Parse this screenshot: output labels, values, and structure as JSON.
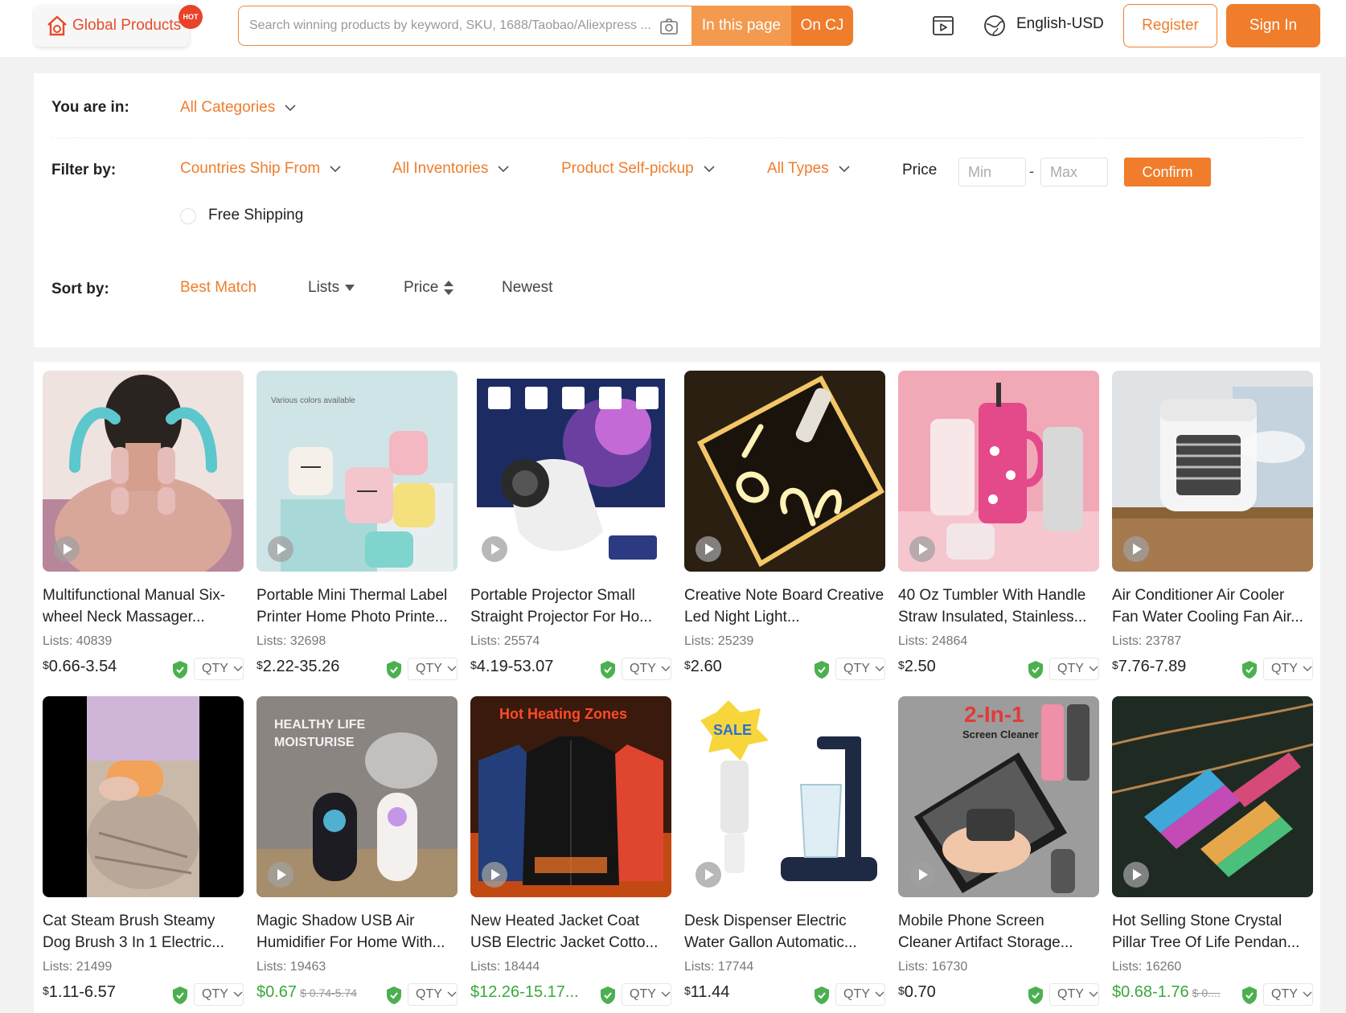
{
  "header": {
    "logo_label": "Global Products",
    "hot_badge": "HOT",
    "search_placeholder": "Search winning products by keyword, SKU, 1688/Taobao/Aliexpress ...",
    "in_page_button": "In this page",
    "on_cj_button": "On CJ",
    "language": "English-USD",
    "register": "Register",
    "sign_in": "Sign In"
  },
  "filters": {
    "location_label": "You are in:",
    "category": "All Categories",
    "filter_label": "Filter by:",
    "ship_from": "Countries Ship From",
    "inventories": "All Inventories",
    "self_pickup": "Product Self-pickup",
    "types": "All Types",
    "price_label": "Price",
    "min_placeholder": "Min",
    "max_placeholder": "Max",
    "dash": "-",
    "confirm": "Confirm",
    "free_shipping": "Free Shipping",
    "sort_label": "Sort by:",
    "sort_options": [
      "Best Match",
      "Lists",
      "Price",
      "Newest"
    ],
    "sort_active": "Best Match"
  },
  "products": [
    {
      "title": "Multifunctional Manual Six-wheel Neck Massager...",
      "lists": "Lists: 40839",
      "price": "0.66-3.54",
      "currency": "$",
      "qty": "QTY"
    },
    {
      "title": "Portable Mini Thermal Label Printer Home Photo Printe...",
      "lists": "Lists: 32698",
      "price": "2.22-35.26",
      "currency": "$",
      "qty": "QTY"
    },
    {
      "title": "Portable Projector Small Straight Projector For Ho...",
      "lists": "Lists: 25574",
      "price": "4.19-53.07",
      "currency": "$",
      "qty": "QTY"
    },
    {
      "title": "Creative Note Board Creative Led Night Light...",
      "lists": "Lists: 25239",
      "price": "2.60",
      "currency": "$",
      "qty": "QTY"
    },
    {
      "title": "40 Oz Tumbler With Handle Straw Insulated, Stainless...",
      "lists": "Lists: 24864",
      "price": "2.50",
      "currency": "$",
      "qty": "QTY"
    },
    {
      "title": "Air Conditioner Air Cooler Fan Water Cooling Fan Air...",
      "lists": "Lists: 23787",
      "price": "7.76-7.89",
      "currency": "$",
      "qty": "QTY"
    },
    {
      "title": "Cat Steam Brush Steamy Dog Brush 3 In 1 Electric...",
      "lists": "Lists: 21499",
      "price": "1.11-6.57",
      "currency": "$",
      "qty": "QTY"
    },
    {
      "title": "Magic Shadow USB Air Humidifier For Home With...",
      "lists": "Lists: 19463",
      "price": "$0.67",
      "original": "$ 0.74-5.74",
      "qty": "QTY"
    },
    {
      "title": "New Heated Jacket Coat USB Electric Jacket Cotto...",
      "lists": "Lists: 18444",
      "price": "$12.26-15.17...",
      "qty": "QTY"
    },
    {
      "title": "Desk Dispenser Electric Water Gallon Automatic...",
      "lists": "Lists: 17744",
      "price": "11.44",
      "currency": "$",
      "qty": "QTY"
    },
    {
      "title": "Mobile Phone Screen Cleaner Artifact Storage...",
      "lists": "Lists: 16730",
      "price": "0.70",
      "currency": "$",
      "qty": "QTY"
    },
    {
      "title": "Hot Selling Stone Crystal Pillar Tree Of Life Pendan...",
      "lists": "Lists: 16260",
      "price": "$0.68-1.76",
      "original": "$ 0....",
      "qty": "QTY"
    }
  ],
  "image_text": {
    "printer_caption": "Various colors available",
    "humidifier_line1": "HEALTHY LIFE",
    "humidifier_line2": "MOISTURISE",
    "jacket_banner": "Hot Heating Zones",
    "dispenser_badge": "SALE",
    "cleaner_big": "2-In-1",
    "cleaner_small": "Screen Cleaner"
  },
  "colors": {
    "accent": "#ef7d2c",
    "accent_light": "#f39a4f",
    "discount_green": "#3aa83b"
  }
}
